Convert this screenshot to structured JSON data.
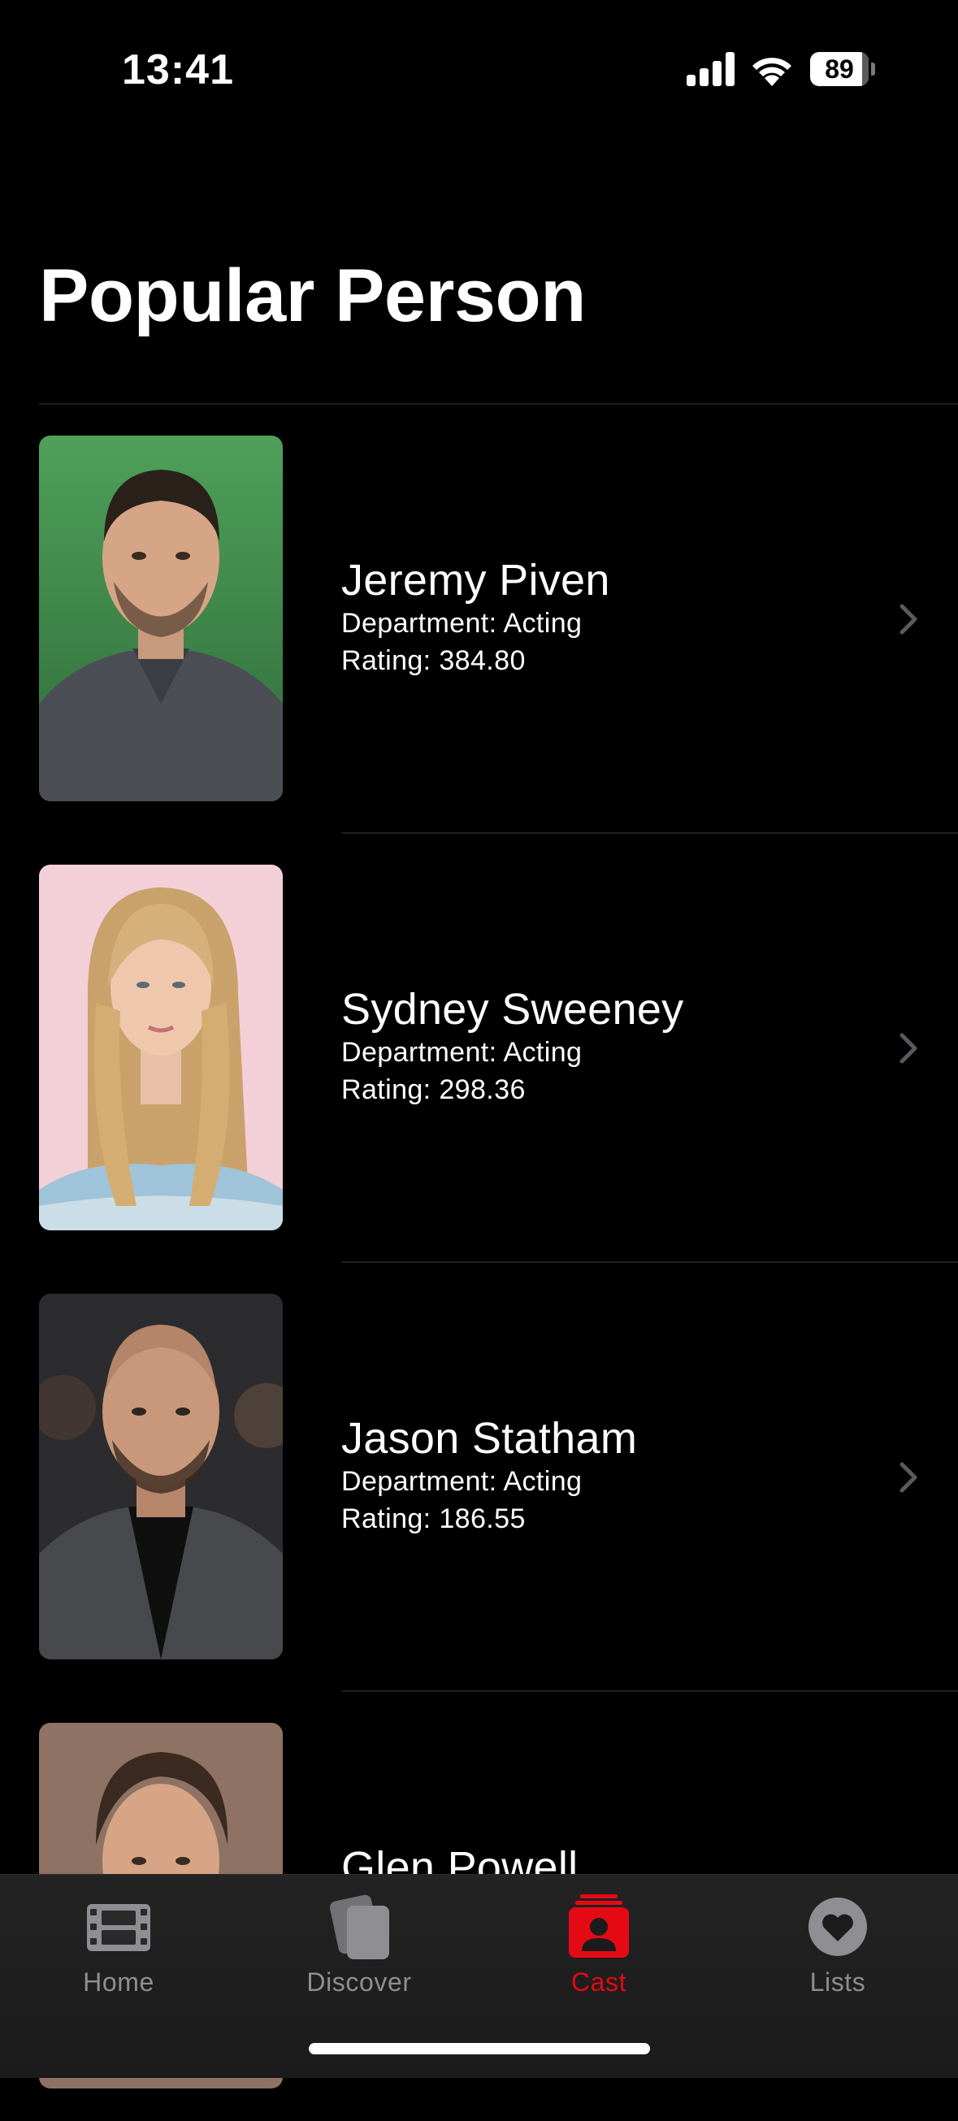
{
  "status_bar": {
    "time": "13:41",
    "battery_level": "89",
    "battery_fraction": 0.89,
    "icons": [
      "cellular-signal-icon",
      "wifi-icon",
      "battery-icon"
    ]
  },
  "page": {
    "title": "Popular Person"
  },
  "people": [
    {
      "name": "Jeremy Piven",
      "department": "Department: Acting",
      "rating": "Rating: 384.80"
    },
    {
      "name": "Sydney Sweeney",
      "department": "Department: Acting",
      "rating": "Rating: 298.36"
    },
    {
      "name": "Jason Statham",
      "department": "Department: Acting",
      "rating": "Rating: 186.55"
    },
    {
      "name": "Glen Powell",
      "department": "",
      "rating": ""
    }
  ],
  "tab_bar": {
    "tabs": [
      {
        "label": "Home",
        "icon": "film-icon",
        "active": false
      },
      {
        "label": "Discover",
        "icon": "cards-icon",
        "active": false
      },
      {
        "label": "Cast",
        "icon": "person-badge-icon",
        "active": true
      },
      {
        "label": "Lists",
        "icon": "heart-icon",
        "active": false
      }
    ]
  },
  "colors": {
    "background": "#000000",
    "accent": "#e50914",
    "inactive_tab": "#8e8e93",
    "divider": "#1f1f1f"
  }
}
